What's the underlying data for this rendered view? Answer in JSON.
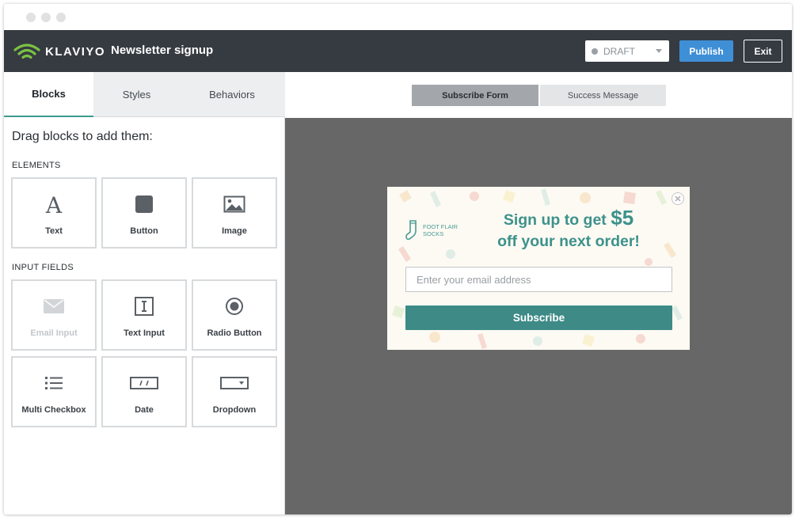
{
  "app": {
    "brand": "KLAVIYO",
    "title": "Newsletter signup",
    "status": "DRAFT",
    "publish_label": "Publish",
    "exit_label": "Exit"
  },
  "sidebar": {
    "tabs": [
      {
        "label": "Blocks",
        "active": true
      },
      {
        "label": "Styles",
        "active": false
      },
      {
        "label": "Behaviors",
        "active": false
      }
    ],
    "drag_title": "Drag blocks to add them:",
    "elements_label": "ELEMENTS",
    "elements": [
      {
        "label": "Text",
        "icon": "text-icon"
      },
      {
        "label": "Button",
        "icon": "button-icon"
      },
      {
        "label": "Image",
        "icon": "image-icon"
      }
    ],
    "input_fields_label": "INPUT FIELDS",
    "input_fields": [
      {
        "label": "Email Input",
        "icon": "envelope-icon",
        "disabled": true
      },
      {
        "label": "Text Input",
        "icon": "text-cursor-icon",
        "disabled": false
      },
      {
        "label": "Radio Button",
        "icon": "radio-icon",
        "disabled": false
      },
      {
        "label": "Multi Checkbox",
        "icon": "list-icon",
        "disabled": false
      },
      {
        "label": "Date",
        "icon": "date-icon",
        "disabled": false
      },
      {
        "label": "Dropdown",
        "icon": "dropdown-icon",
        "disabled": false
      }
    ]
  },
  "canvas": {
    "tabs": [
      {
        "label": "Subscribe Form",
        "active": true
      },
      {
        "label": "Success Message",
        "active": false
      }
    ]
  },
  "popup": {
    "brand_line1": "FOOT FLAIR",
    "brand_line2": "SOCKS",
    "headline_part1": "Sign up to get ",
    "headline_amount": "$5",
    "headline_part2": "off your next order!",
    "email_placeholder": "Enter your email address",
    "subscribe_label": "Subscribe"
  },
  "colors": {
    "appbar": "#363b42",
    "publish": "#3f8fd6",
    "accent_teal": "#3d8a87",
    "canvas_bg": "#676767"
  }
}
